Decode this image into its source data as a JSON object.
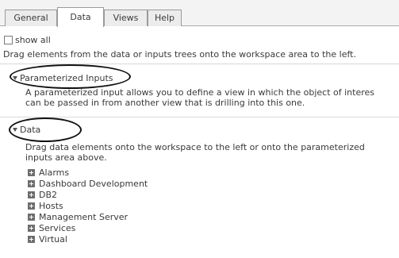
{
  "tabs": [
    "General",
    "Data",
    "Views",
    "Help"
  ],
  "active_tab": "Data",
  "show_all": {
    "label": "show all",
    "checked": false
  },
  "hint": "Drag elements from the data or inputs trees onto the workspace area to the left.",
  "param_section": {
    "title": "Parameterized Inputs",
    "description_line1": "A parameterized input allows you to define a view in which the object of interes",
    "description_line2": "can be passed in from another view that is drilling into this one."
  },
  "data_section": {
    "title": "Data",
    "description_line1": "Drag data elements onto the workspace to the left or onto the parameterized",
    "description_line2": "inputs area above.",
    "items": [
      "Alarms",
      "Dashboard Development",
      "DB2",
      "Hosts",
      "Management Server",
      "Services",
      "Virtual"
    ]
  },
  "colors": {
    "tab_bar": "#f3f3f3",
    "separator": "#d9d9d9",
    "annotation": "#111111"
  }
}
